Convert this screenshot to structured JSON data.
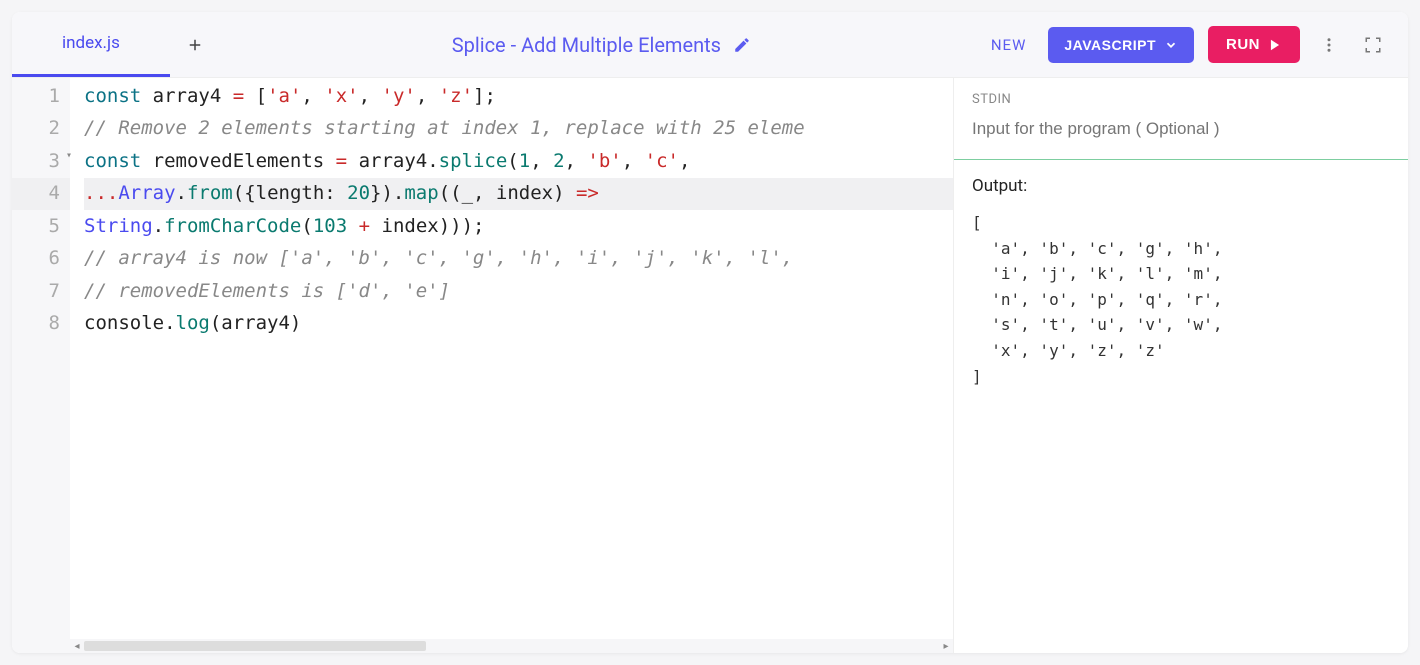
{
  "tabs": [
    {
      "label": "index.js",
      "active": true
    }
  ],
  "title": "Splice - Add Multiple Elements",
  "actions": {
    "new_label": "NEW",
    "language_label": "JAVASCRIPT",
    "run_label": "RUN"
  },
  "gutter": [
    "1",
    "2",
    "3",
    "4",
    "5",
    "6",
    "7",
    "8"
  ],
  "code_lines": [
    {
      "n": 1,
      "tokens": [
        [
          "kw",
          "const"
        ],
        [
          "",
          " array4 "
        ],
        [
          "op",
          "="
        ],
        [
          "",
          " ["
        ],
        [
          "str",
          "'a'"
        ],
        [
          "",
          ", "
        ],
        [
          "str",
          "'x'"
        ],
        [
          "",
          ", "
        ],
        [
          "str",
          "'y'"
        ],
        [
          "",
          ", "
        ],
        [
          "str",
          "'z'"
        ],
        [
          "",
          "];"
        ]
      ]
    },
    {
      "n": 2,
      "tokens": [
        [
          "cmt",
          "// Remove 2 elements starting at index 1, replace with 25 eleme"
        ]
      ]
    },
    {
      "n": 3,
      "fold": true,
      "tokens": [
        [
          "kw",
          "const"
        ],
        [
          "",
          " removedElements "
        ],
        [
          "op",
          "="
        ],
        [
          "",
          " array4."
        ],
        [
          "fn",
          "splice"
        ],
        [
          "",
          "("
        ],
        [
          "num",
          "1"
        ],
        [
          "",
          ", "
        ],
        [
          "num",
          "2"
        ],
        [
          "",
          ", "
        ],
        [
          "str",
          "'b'"
        ],
        [
          "",
          ", "
        ],
        [
          "str",
          "'c'"
        ],
        [
          "",
          ","
        ]
      ]
    },
    {
      "n": 4,
      "active": true,
      "tokens": [
        [
          "op",
          "..."
        ],
        [
          "cls",
          "Array"
        ],
        [
          "",
          "."
        ],
        [
          "fn",
          "from"
        ],
        [
          "",
          "({length: "
        ],
        [
          "num",
          "20"
        ],
        [
          "",
          "})."
        ],
        [
          "fn",
          "map"
        ],
        [
          "",
          "((_, index) "
        ],
        [
          "op",
          "=>"
        ]
      ]
    },
    {
      "n": 5,
      "tokens": [
        [
          "cls",
          "String"
        ],
        [
          "",
          "."
        ],
        [
          "fn",
          "fromCharCode"
        ],
        [
          "",
          "("
        ],
        [
          "num",
          "103"
        ],
        [
          "",
          " "
        ],
        [
          "op",
          "+"
        ],
        [
          "",
          " index)));"
        ]
      ]
    },
    {
      "n": 6,
      "tokens": [
        [
          "cmt",
          "// array4 is now ['a', 'b', 'c', 'g', 'h', 'i', 'j', 'k', 'l',"
        ]
      ]
    },
    {
      "n": 7,
      "tokens": [
        [
          "cmt",
          "// removedElements is ['d', 'e']"
        ]
      ]
    },
    {
      "n": 8,
      "tokens": [
        [
          "",
          "console."
        ],
        [
          "fn",
          "log"
        ],
        [
          "",
          "(array4)"
        ]
      ]
    }
  ],
  "stdin": {
    "label": "STDIN",
    "placeholder": "Input for the program ( Optional )"
  },
  "output": {
    "label": "Output:",
    "text": "[\n  'a', 'b', 'c', 'g', 'h',\n  'i', 'j', 'k', 'l', 'm',\n  'n', 'o', 'p', 'q', 'r',\n  's', 't', 'u', 'v', 'w',\n  'x', 'y', 'z', 'z'\n]"
  }
}
